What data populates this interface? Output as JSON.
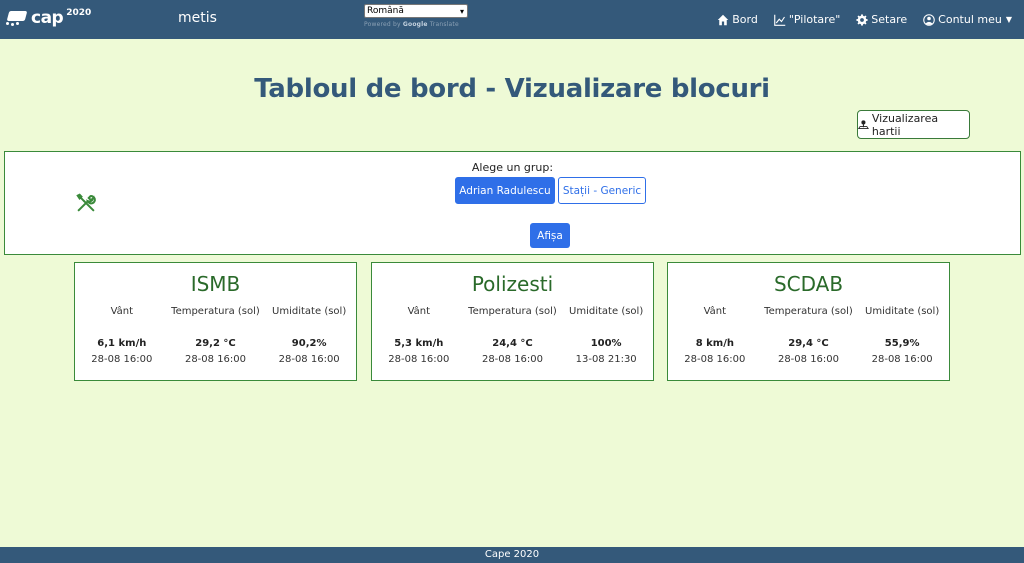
{
  "navbar": {
    "logo_text": "cap",
    "logo_sup": "2020",
    "brand": "metis",
    "language": {
      "selected": "Română",
      "powered_by_prefix": "Powered by",
      "powered_by_google": "Google",
      "powered_by_suffix": "Translate"
    },
    "links": [
      {
        "label": "Bord",
        "icon": "home-icon"
      },
      {
        "label": "\"Pilotare\"",
        "icon": "chart-line-icon"
      },
      {
        "label": "Setare",
        "icon": "gear-icon"
      },
      {
        "label": "Contul meu",
        "icon": "user-circle-icon"
      }
    ]
  },
  "page": {
    "title": "Tabloul de bord - Vizualizare blocuri",
    "map_button": "Vizualizarea hartii"
  },
  "group_panel": {
    "label": "Alege un grup:",
    "groups": [
      "Adrian Radulescu",
      "Stații - Generic"
    ],
    "selected_group": "Adrian Radulescu",
    "show_button": "Afișa"
  },
  "stations": [
    {
      "name": "ISMB",
      "metrics": [
        {
          "label": "Vânt",
          "value": "6,1 km/h",
          "time": "28-08 16:00"
        },
        {
          "label": "Temperatura (sol)",
          "value": "29,2 °C",
          "time": "28-08 16:00"
        },
        {
          "label": "Umiditate (sol)",
          "value": "90,2%",
          "time": "28-08 16:00"
        }
      ]
    },
    {
      "name": "Polizesti",
      "metrics": [
        {
          "label": "Vânt",
          "value": "5,3 km/h",
          "time": "28-08 16:00"
        },
        {
          "label": "Temperatura (sol)",
          "value": "24,4 °C",
          "time": "28-08 16:00"
        },
        {
          "label": "Umiditate (sol)",
          "value": "100%",
          "time": "13-08 21:30"
        }
      ]
    },
    {
      "name": "SCDAB",
      "metrics": [
        {
          "label": "Vânt",
          "value": "8 km/h",
          "time": "28-08 16:00"
        },
        {
          "label": "Temperatura (sol)",
          "value": "29,4 °C",
          "time": "28-08 16:00"
        },
        {
          "label": "Umiditate (sol)",
          "value": "55,9%",
          "time": "28-08 16:00"
        }
      ]
    }
  ],
  "footer": {
    "text": "Cape 2020"
  },
  "colors": {
    "navbar": "#34597a",
    "background": "#eefad6",
    "primary": "#2f6fe8",
    "card_border": "#3a8a3a",
    "station_title": "#2a6a2a"
  }
}
